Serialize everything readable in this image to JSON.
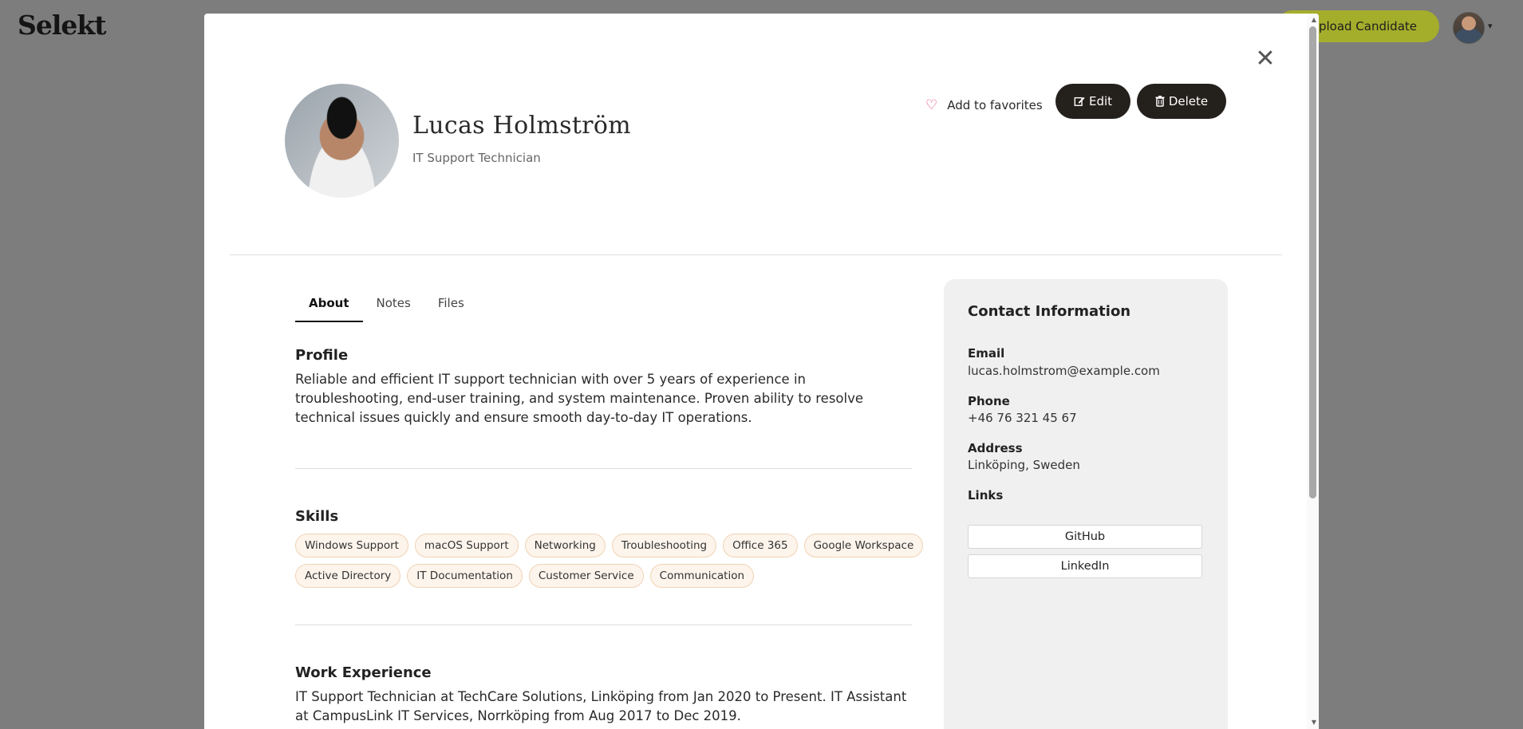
{
  "app": {
    "logo": "Selekt",
    "upload_label": "Upload Candidate"
  },
  "modal": {
    "close_glyph": "✕"
  },
  "candidate": {
    "name": "Lucas Holmström",
    "title": "IT Support Technician"
  },
  "actions": {
    "favorite_label": "Add to favorites",
    "edit_label": "Edit",
    "delete_label": "Delete"
  },
  "tabs": [
    {
      "label": "About",
      "active": true
    },
    {
      "label": "Notes",
      "active": false
    },
    {
      "label": "Files",
      "active": false
    }
  ],
  "about": {
    "profile_heading": "Profile",
    "profile_text": "Reliable and efficient IT support technician with over 5 years of experience in troubleshooting, end-user training, and system maintenance. Proven ability to resolve technical issues quickly and ensure smooth day-to-day IT operations.",
    "skills_heading": "Skills",
    "skills": [
      "Windows Support",
      "macOS Support",
      "Networking",
      "Troubleshooting",
      "Office 365",
      "Google Workspace",
      "Active Directory",
      "IT Documentation",
      "Customer Service",
      "Communication"
    ],
    "work_heading": "Work Experience",
    "work_text": "IT Support Technician at TechCare Solutions, Linköping from Jan 2020 to Present. IT Assistant at CampusLink IT Services, Norrköping from Aug 2017 to Dec 2019."
  },
  "contact": {
    "heading": "Contact Information",
    "email_label": "Email",
    "email": "lucas.holmstrom@example.com",
    "phone_label": "Phone",
    "phone": "+46 76 321 45 67",
    "address_label": "Address",
    "address": "Linköping, Sweden",
    "links_label": "Links",
    "links": [
      "GitHub",
      "LinkedIn"
    ]
  },
  "colors": {
    "overlay": "#7d7d7d",
    "accent": "#a5ae2b",
    "dark_button": "#24201c",
    "heart": "#e0457b",
    "chip_bg": "#fdf4ec",
    "chip_border": "#f0d3b4",
    "panel_bg": "#f0f0f0"
  },
  "icons": {
    "favorite": "heart-outline-icon",
    "edit": "edit-icon",
    "delete": "trash-icon",
    "close": "close-icon",
    "menu": "chevron-down-icon"
  }
}
